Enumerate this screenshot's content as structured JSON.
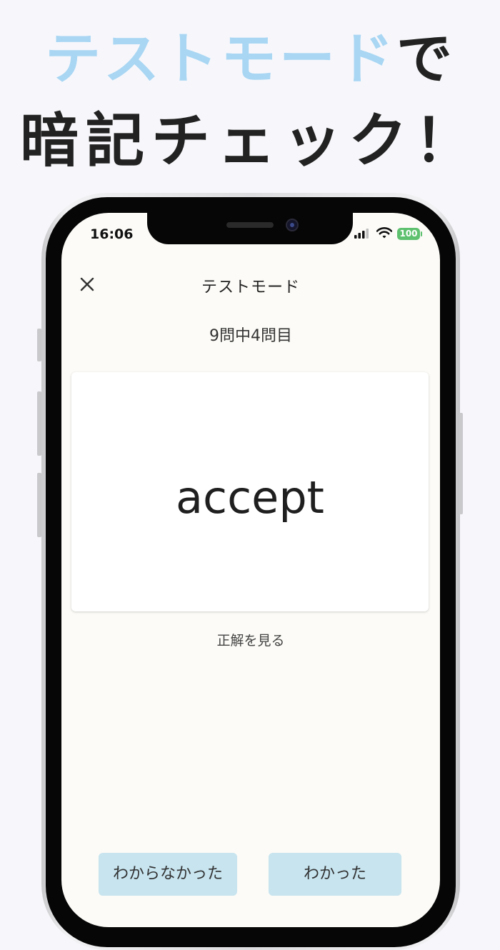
{
  "promo": {
    "line1_accent": "テストモード",
    "line1_rest": "で",
    "line2": "暗記チェック！",
    "accent_color": "#a9d6f3"
  },
  "status_bar": {
    "time": "16:06",
    "battery": "100",
    "battery_color": "#5ec16f"
  },
  "nav": {
    "close_icon": "close-icon",
    "title": "テストモード"
  },
  "quiz": {
    "progress": "9問中4問目",
    "word": "accept",
    "reveal_label": "正解を見る"
  },
  "buttons": {
    "dont_know": "わからなかった",
    "know": "わかった",
    "button_color": "#c7e4ef"
  }
}
